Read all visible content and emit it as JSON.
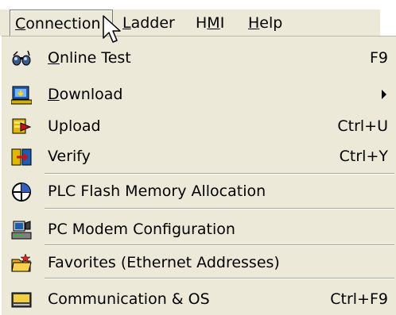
{
  "menubar": {
    "items": [
      {
        "label_pre": "",
        "label_ul": "C",
        "label_post": "onnection"
      },
      {
        "label_pre": "",
        "label_ul": "L",
        "label_post": "adder"
      },
      {
        "label_pre": "H",
        "label_ul": "M",
        "label_post": "I"
      },
      {
        "label_pre": "",
        "label_ul": "H",
        "label_post": "elp"
      }
    ]
  },
  "menu": {
    "items": [
      {
        "ul": "O",
        "rest": "nline Test",
        "shortcut": "F9",
        "icon": "glasses-icon"
      },
      {
        "ul": "D",
        "rest": "ownload",
        "shortcut": "",
        "icon": "download-icon",
        "submenu": true
      },
      {
        "ul": "",
        "rest": "Upload",
        "shortcut": "Ctrl+U",
        "icon": "upload-icon"
      },
      {
        "ul": "",
        "rest": "Verify",
        "shortcut": "Ctrl+Y",
        "icon": "verify-icon"
      },
      {
        "ul": "",
        "rest": "PLC Flash Memory Allocation",
        "shortcut": "",
        "icon": "flash-memory-icon"
      },
      {
        "ul": "",
        "rest": "PC Modem Configuration",
        "shortcut": "",
        "icon": "modem-icon"
      },
      {
        "ul": "",
        "rest": "Favorites (Ethernet Addresses)",
        "shortcut": "",
        "icon": "favorites-folder-icon"
      },
      {
        "ul": "",
        "rest": "Communication & OS",
        "shortcut": "Ctrl+F9",
        "icon": "communication-icon"
      }
    ]
  },
  "colors": {
    "menu_background": "#ece9d8",
    "separator": "#a9a69a",
    "text": "#000000"
  }
}
